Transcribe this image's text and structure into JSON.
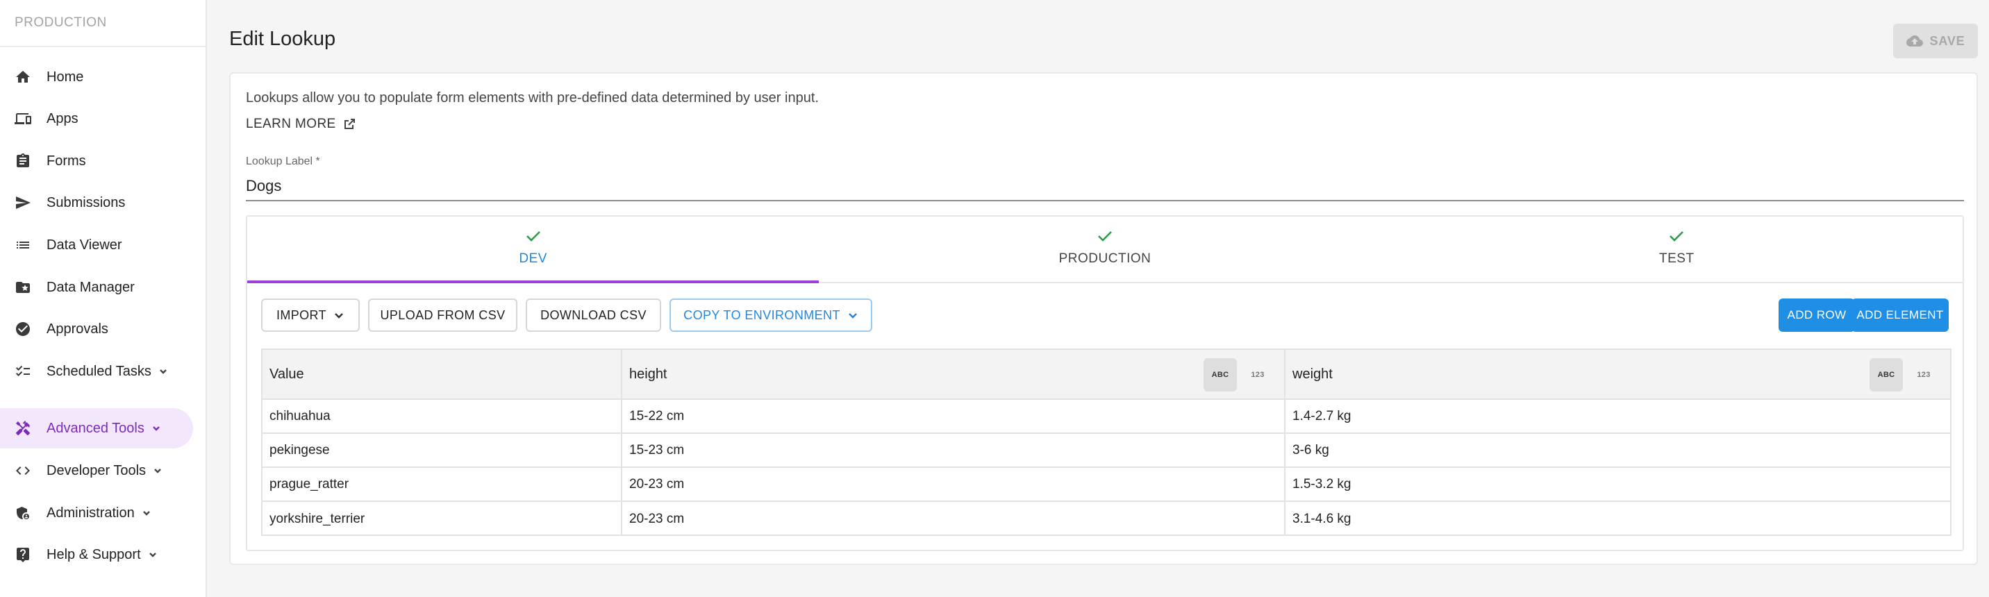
{
  "sidebar": {
    "environment": "PRODUCTION",
    "items": [
      {
        "label": "Home",
        "icon": "home-icon",
        "active": false,
        "chevron": false
      },
      {
        "label": "Apps",
        "icon": "devices-icon",
        "active": false,
        "chevron": false
      },
      {
        "label": "Forms",
        "icon": "clipboard-icon",
        "active": false,
        "chevron": false
      },
      {
        "label": "Submissions",
        "icon": "send-icon",
        "active": false,
        "chevron": false
      },
      {
        "label": "Data Viewer",
        "icon": "list-icon",
        "active": false,
        "chevron": false
      },
      {
        "label": "Data Manager",
        "icon": "folder-star-icon",
        "active": false,
        "chevron": false
      },
      {
        "label": "Approvals",
        "icon": "check-circle-icon",
        "active": false,
        "chevron": false
      },
      {
        "label": "Scheduled Tasks",
        "icon": "checklist-icon",
        "active": false,
        "chevron": true
      },
      {
        "label": "Advanced Tools",
        "icon": "tools-icon",
        "active": true,
        "chevron": true
      },
      {
        "label": "Developer Tools",
        "icon": "code-icon",
        "active": false,
        "chevron": true
      },
      {
        "label": "Administration",
        "icon": "admin-shield-icon",
        "active": false,
        "chevron": true
      },
      {
        "label": "Help & Support",
        "icon": "help-icon",
        "active": false,
        "chevron": true
      }
    ]
  },
  "header": {
    "title": "Edit Lookup",
    "save_label": "SAVE"
  },
  "card": {
    "description": "Lookups allow you to populate form elements with pre-defined data determined by user input.",
    "learn_more": "LEARN MORE",
    "field_label": "Lookup Label *",
    "field_value": "Dogs"
  },
  "tabs": [
    {
      "label": "DEV",
      "active": true
    },
    {
      "label": "PRODUCTION",
      "active": false
    },
    {
      "label": "TEST",
      "active": false
    }
  ],
  "toolbar": {
    "import": "IMPORT",
    "upload_csv": "UPLOAD FROM CSV",
    "download_csv": "DOWNLOAD CSV",
    "copy_env": "COPY TO ENVIRONMENT",
    "add_row": "ADD ROW",
    "add_element": "ADD ELEMENT"
  },
  "table": {
    "columns": [
      {
        "name": "Value"
      },
      {
        "name": "height",
        "types": [
          "ABC",
          "123"
        ],
        "selected": "ABC"
      },
      {
        "name": "weight",
        "types": [
          "ABC",
          "123"
        ],
        "selected": "ABC"
      }
    ],
    "rows": [
      [
        "chihuahua",
        "15-22 cm",
        "1.4-2.7 kg"
      ],
      [
        "pekingese",
        "15-23 cm",
        "3-6 kg"
      ],
      [
        "prague_ratter",
        "20-23 cm",
        "1.5-3.2 kg"
      ],
      [
        "yorkshire_terrier",
        "20-23 cm",
        "3.1-4.6 kg"
      ]
    ]
  },
  "colors": {
    "accent_purple": "#7b2cbf",
    "primary_blue": "#1f8fe6",
    "check_green": "#2e9d4a"
  }
}
